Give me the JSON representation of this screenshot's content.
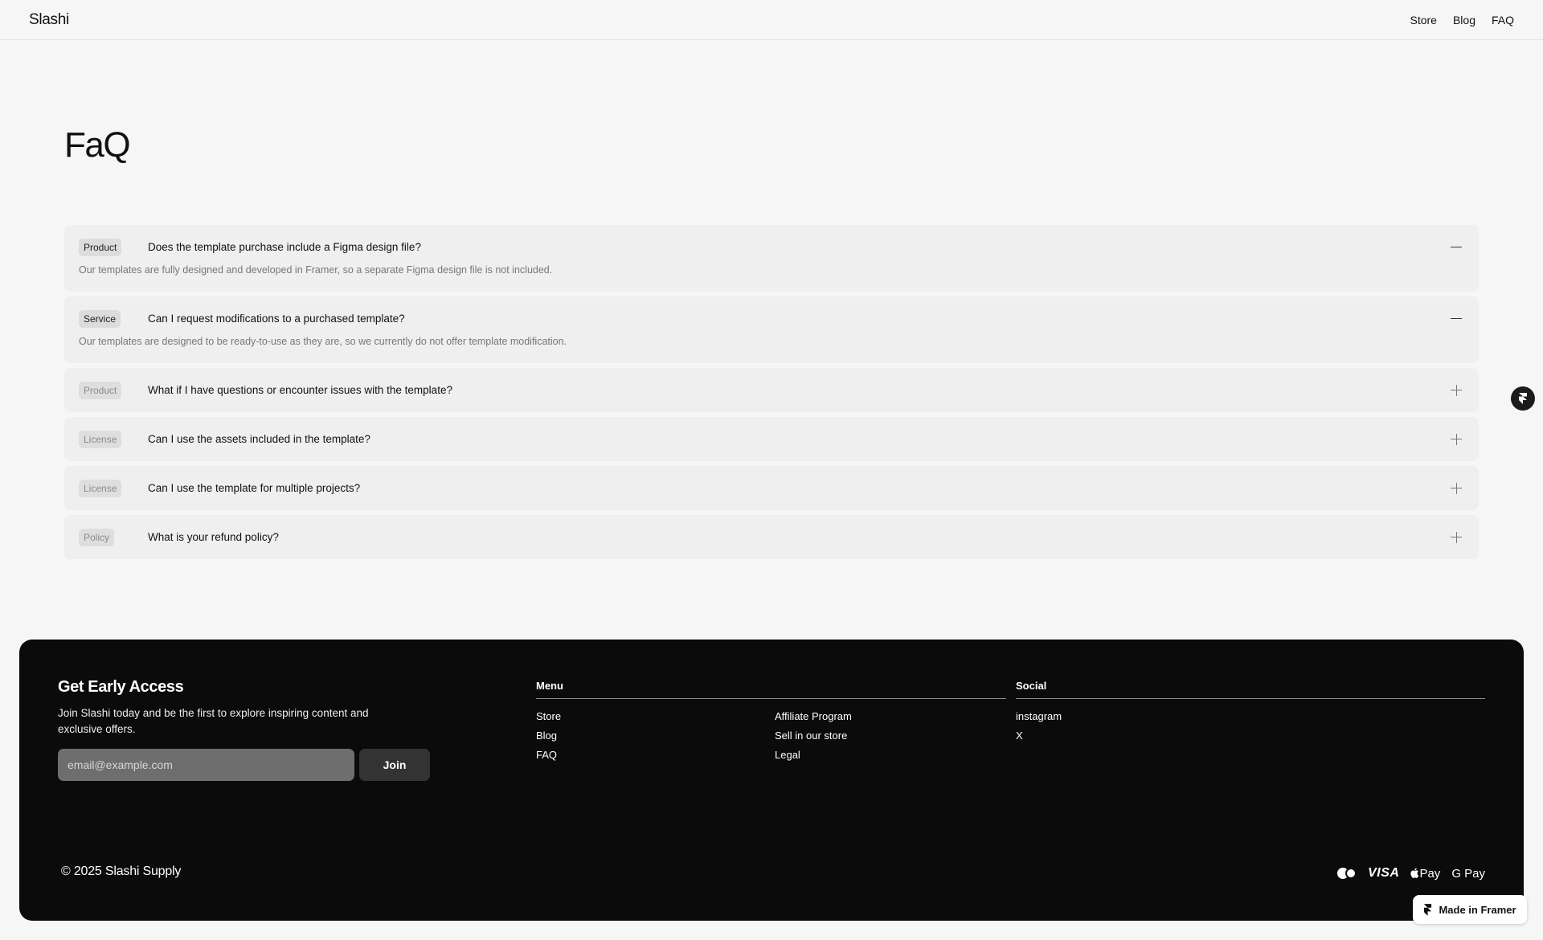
{
  "header": {
    "logo": "Slashi",
    "nav": [
      "Store",
      "Blog",
      "FAQ"
    ]
  },
  "page_title": "FaQ",
  "faq": [
    {
      "tag": "Product",
      "question": "Does the template purchase include a Figma design file?",
      "answer": "Our templates are fully designed and developed in Framer, so a separate Figma design file is not included.",
      "expanded": true
    },
    {
      "tag": "Service",
      "question": "Can I request modifications to a purchased template?",
      "answer": "Our templates are designed to be ready-to-use as they are, so we currently do not offer template modification.",
      "expanded": true
    },
    {
      "tag": "Product",
      "question": "What if I have questions or encounter issues with the template?",
      "answer": "",
      "expanded": false
    },
    {
      "tag": "License",
      "question": "Can I use the assets included in the template?",
      "answer": "",
      "expanded": false
    },
    {
      "tag": "License",
      "question": "Can I use the template for multiple projects?",
      "answer": "",
      "expanded": false
    },
    {
      "tag": "Policy",
      "question": "What is your refund policy?",
      "answer": "",
      "expanded": false
    }
  ],
  "footer": {
    "early_access": {
      "title": "Get Early Access",
      "description": "Join Slashi today and be the first to explore inspiring content and exclusive offers.",
      "email_placeholder": "email@example.com",
      "join_label": "Join"
    },
    "menu": {
      "heading": "Menu",
      "col1": [
        "Store",
        "Blog",
        "FAQ"
      ],
      "col2": [
        "Affiliate Program",
        "Sell in our store",
        "Legal"
      ]
    },
    "social": {
      "heading": "Social",
      "links": [
        "instagram",
        "X"
      ]
    },
    "copyright": "© 2025 Slashi Supply",
    "payments": {
      "mastercard_icon": "mastercard-icon",
      "visa": "VISA",
      "apple_pay": "Pay",
      "google_pay": "G Pay"
    }
  },
  "made_in_framer": "Made in Framer",
  "icons": {
    "expanded": "minus-icon",
    "collapsed": "plus-icon",
    "framer": "framer-icon"
  }
}
